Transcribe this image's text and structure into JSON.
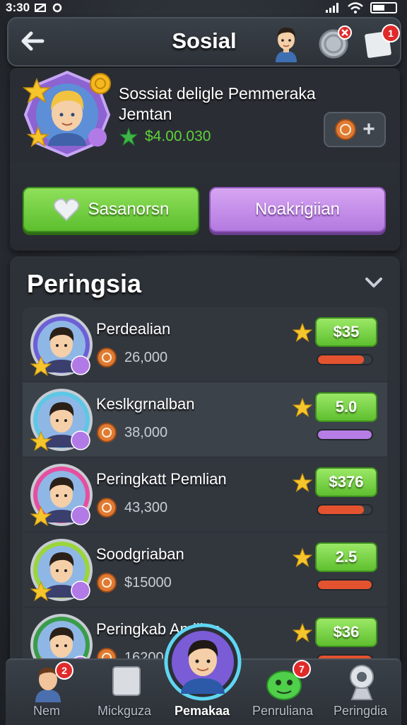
{
  "status_bar": {
    "time": "3:30"
  },
  "header": {
    "title": "Sosial",
    "back_icon": "arrow-left-icon",
    "notif_badge": "1"
  },
  "profile": {
    "name": "Sossiat deligle Pemmeraka Jemtan",
    "money": "$4.00.030",
    "add_symbol": "+",
    "primary_button": "Sasanorsn",
    "secondary_button": "Noakrigiian"
  },
  "leaderboard": {
    "title": "Peringsia",
    "rows": [
      {
        "name": "Perdealian",
        "score": "26,000",
        "value": "$35",
        "progress": 0.85,
        "bar_color": "#e4532f",
        "ring": "#6d5fd6",
        "highlight": false
      },
      {
        "name": "Keslkgrnalban",
        "score": "38,000",
        "value": "5.0",
        "progress": 1.0,
        "bar_color": "#b77de6",
        "ring": "#5fc7e6",
        "highlight": true
      },
      {
        "name": "Peringkatt Pemlian",
        "score": "43,300",
        "value": "$376",
        "progress": 0.85,
        "bar_color": "#e4532f",
        "ring": "#e64fa0",
        "highlight": false
      },
      {
        "name": "Soodgriaban",
        "score": "$15000",
        "value": "2.5",
        "progress": 1.0,
        "bar_color": "#e4532f",
        "ring": "#9ad63a",
        "highlight": false
      },
      {
        "name": "Peringkab Amilian",
        "score": "16200",
        "value": "$36",
        "progress": 1.0,
        "bar_color": "#e4532f",
        "ring": "#3a9c4a",
        "highlight": false
      }
    ]
  },
  "bottom_nav": {
    "items": [
      {
        "label": "Nem",
        "badge": "2"
      },
      {
        "label": "Mickguza"
      },
      {
        "label": "Pemakaa"
      },
      {
        "label": "Penruliana",
        "badge": "7"
      },
      {
        "label": "Peringdia"
      }
    ]
  },
  "colors": {
    "accent_green": "#5fbf2f",
    "accent_purple": "#b47ae0",
    "money_green": "#5fd13a"
  }
}
